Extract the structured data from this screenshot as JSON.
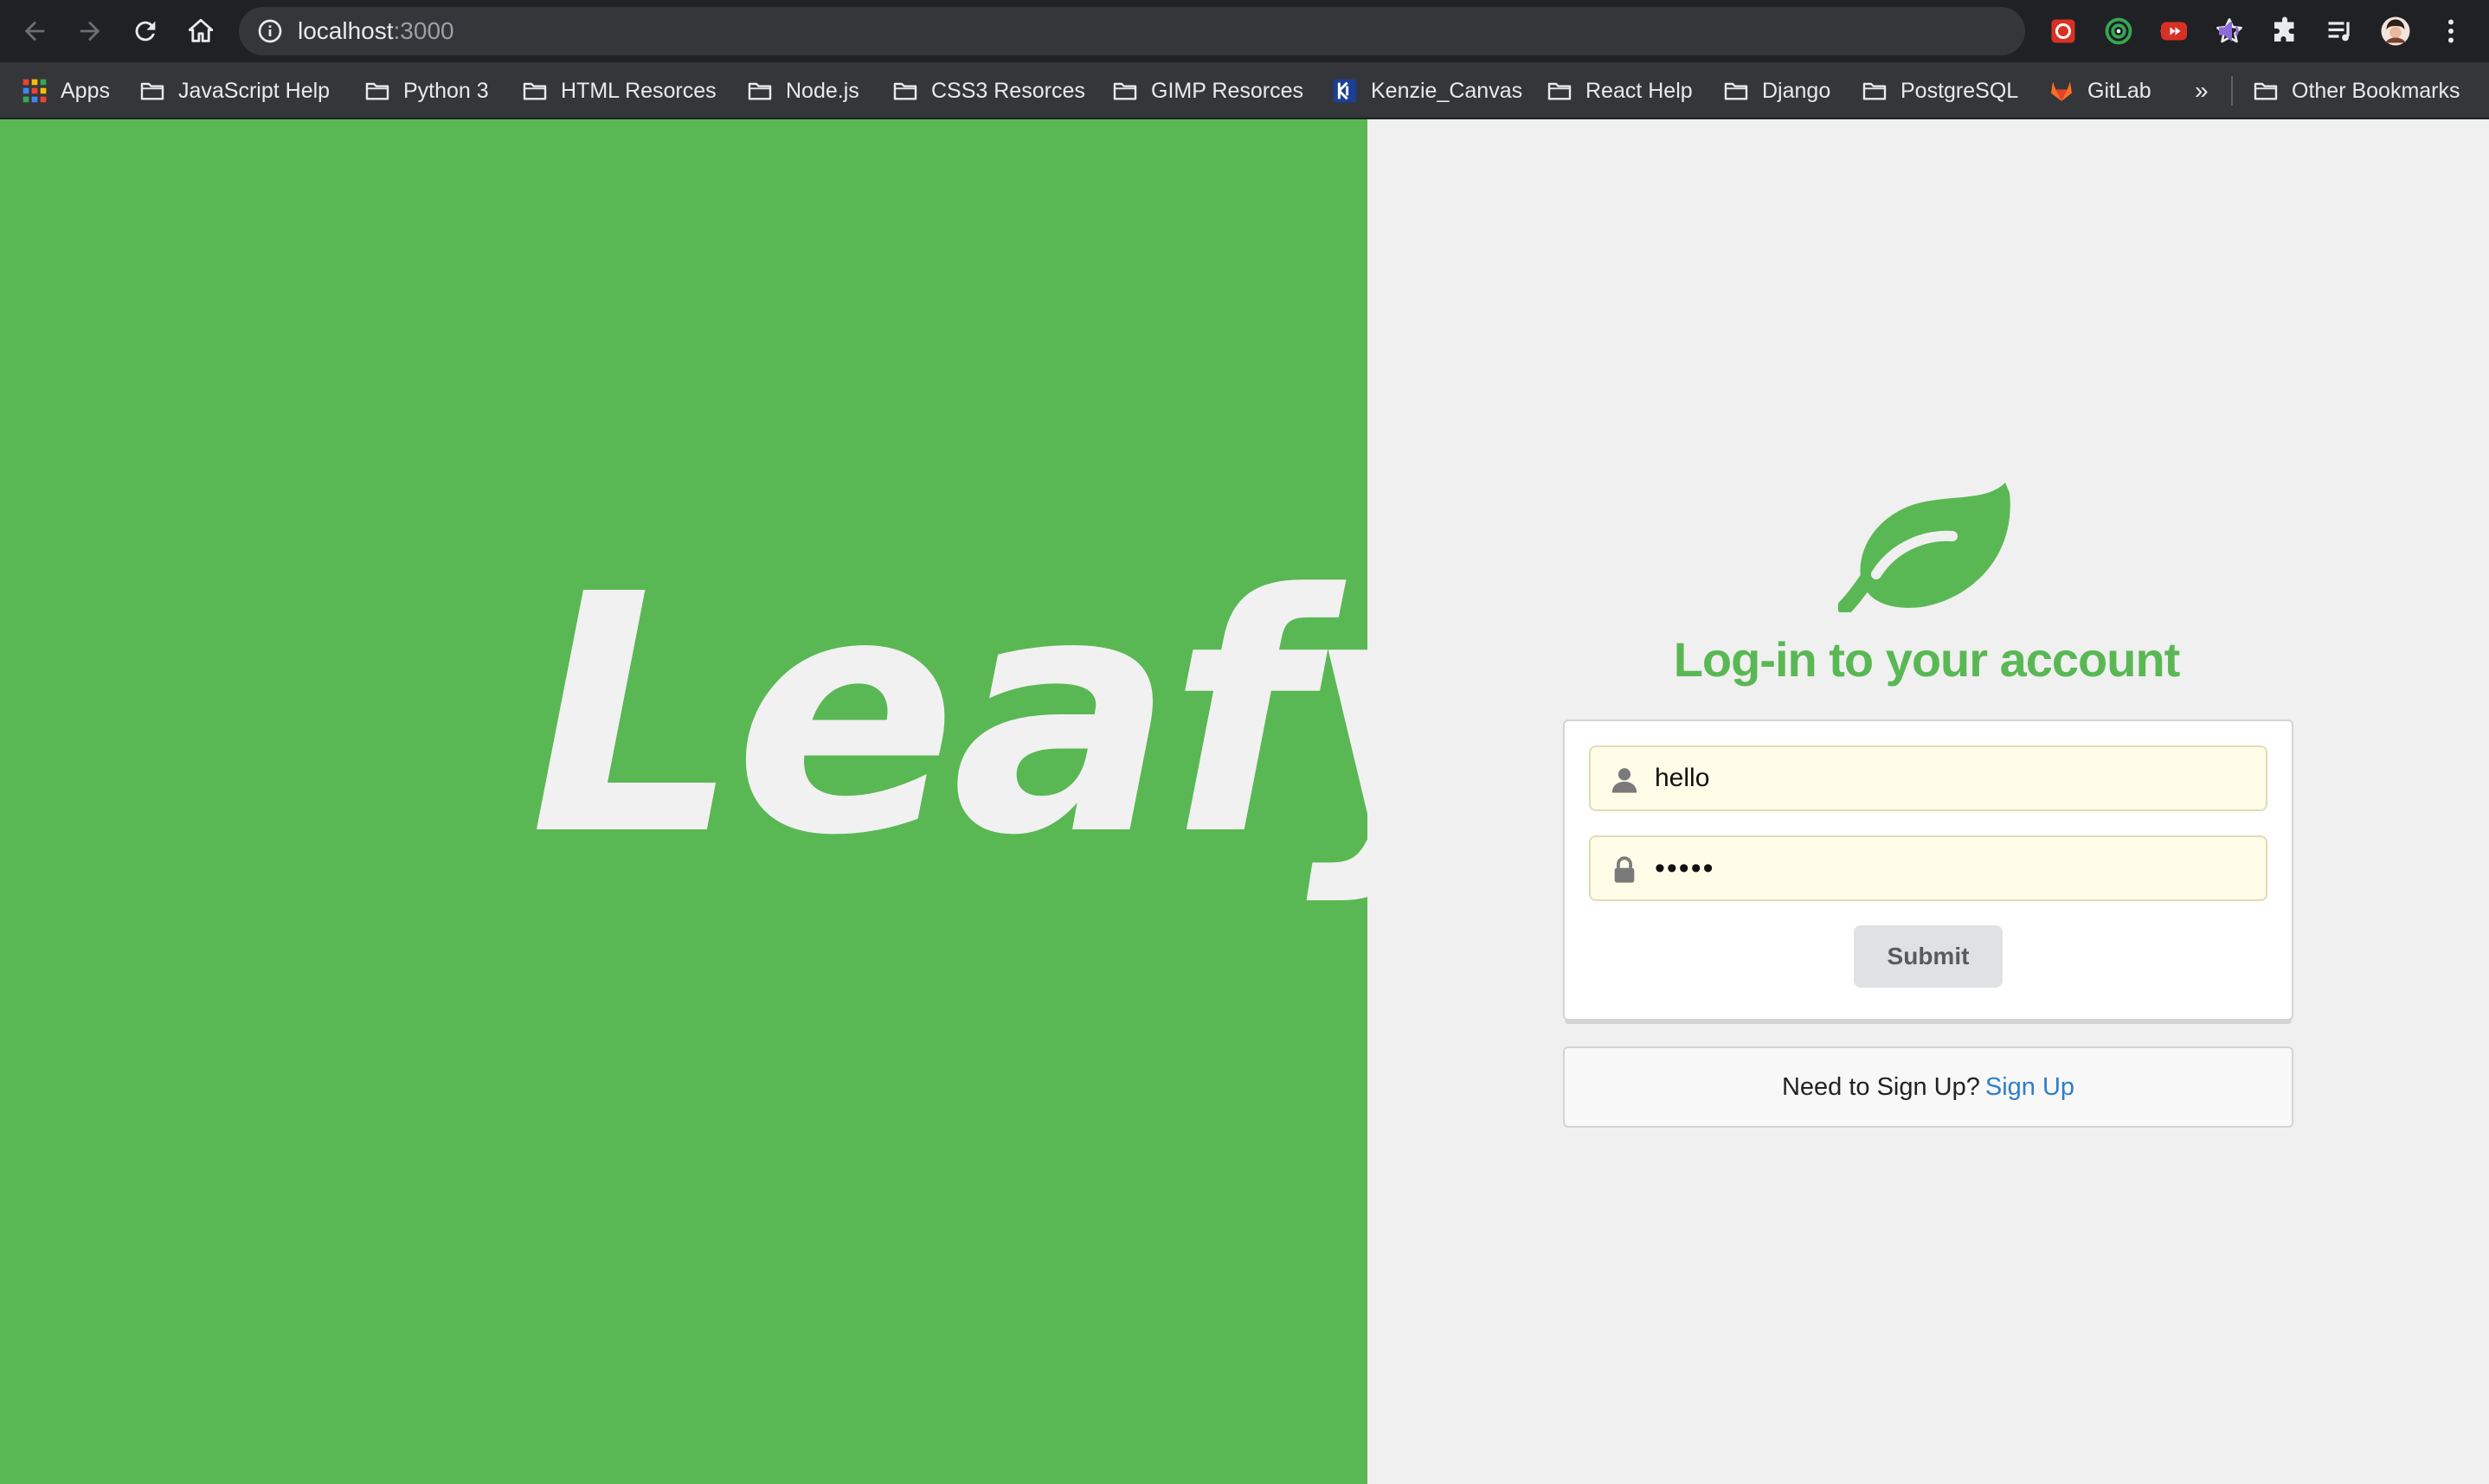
{
  "browser": {
    "url_host": "localhost",
    "url_port": ":3000",
    "icons": {
      "back": "back-arrow-icon",
      "forward": "forward-arrow-icon",
      "reload": "reload-icon",
      "home": "home-icon",
      "site_info": "info-icon",
      "password_key": "key-icon",
      "bookmark_star": "star-icon",
      "extensions": [
        "red-extension-icon",
        "green-target-extension-icon",
        "youtube-extension-icon",
        "purple-speaker-extension-icon",
        "puzzle-extensions-icon",
        "media-queue-icon",
        "profile-avatar",
        "kebab-menu-icon"
      ]
    }
  },
  "bookmarks": {
    "items": [
      {
        "label": "Apps",
        "icon": "apps-grid-icon"
      },
      {
        "label": "JavaScript Help",
        "icon": "folder-icon"
      },
      {
        "label": "Python 3",
        "icon": "folder-icon"
      },
      {
        "label": "HTML Resorces",
        "icon": "folder-icon"
      },
      {
        "label": "Node.js",
        "icon": "folder-icon"
      },
      {
        "label": "CSS3 Resorces",
        "icon": "folder-icon"
      },
      {
        "label": "GIMP Resorces",
        "icon": "folder-icon"
      },
      {
        "label": "Kenzie_Canvas",
        "icon": "kenzie-icon"
      },
      {
        "label": "React Help",
        "icon": "folder-icon"
      },
      {
        "label": "Django",
        "icon": "folder-icon"
      },
      {
        "label": "PostgreSQL",
        "icon": "folder-icon"
      },
      {
        "label": "GitLab",
        "icon": "gitlab-icon"
      }
    ],
    "overflow": "»",
    "other": "Other Bookmarks"
  },
  "page": {
    "brand": "Leafy",
    "login_title": "Log-in to your account",
    "username_value": "hello",
    "password_value": "•••••",
    "submit_label": "Submit",
    "signup_prompt": "Need to Sign Up?",
    "signup_link": "Sign Up",
    "colors": {
      "brand_green": "#5ab854",
      "link_blue": "#2f7ec8",
      "autofill_yellow": "#fffde8"
    }
  }
}
